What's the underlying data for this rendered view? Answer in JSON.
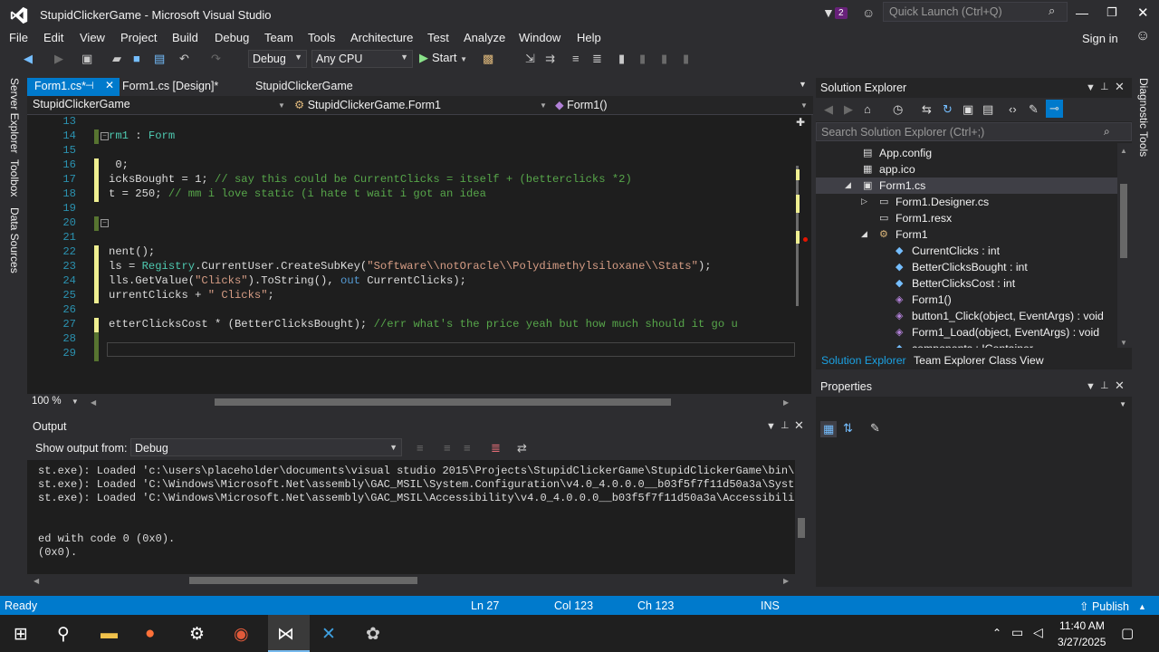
{
  "title_bar": {
    "title": "StupidClickerGame - Microsoft Visual Studio",
    "notification_count": "2",
    "quick_launch_placeholder": "Quick Launch (Ctrl+Q)"
  },
  "menu": {
    "items": [
      "File",
      "Edit",
      "View",
      "Project",
      "Build",
      "Debug",
      "Team",
      "Tools",
      "Architecture",
      "Test",
      "Analyze",
      "Window",
      "Help"
    ],
    "sign_in": "Sign in"
  },
  "toolbar": {
    "configuration": "Debug",
    "platform": "Any CPU",
    "start_label": "Start"
  },
  "left_sidebar": {
    "tabs": [
      "Server Explorer",
      "Toolbox",
      "Data Sources"
    ]
  },
  "editor": {
    "tabs": [
      "Form1.cs*",
      "Form1.cs [Design]*",
      "StupidClickerGame"
    ],
    "nav": {
      "project": "StupidClickerGame",
      "class": "StupidClickerGame.Form1",
      "member": "Form1()"
    },
    "lines": [
      {
        "num": "13",
        "text": ""
      },
      {
        "num": "14",
        "text": "rm1 : Form"
      },
      {
        "num": "15",
        "text": ""
      },
      {
        "num": "16",
        "text": " 0;"
      },
      {
        "num": "17",
        "text": "icksBought = 1; // say this could be CurrentClicks = itself + (betterclicks *2)"
      },
      {
        "num": "18",
        "text": "t = 250; // mm i love static (i hate t wait i got an idea"
      },
      {
        "num": "19",
        "text": ""
      },
      {
        "num": "20",
        "text": ""
      },
      {
        "num": "21",
        "text": ""
      },
      {
        "num": "22",
        "text": "nent();"
      },
      {
        "num": "23",
        "text": "ls = Registry.CurrentUser.CreateSubKey(\"Software\\\\notOracle\\\\Polydimethylsiloxane\\\\Stats\");"
      },
      {
        "num": "24",
        "text": "lls.GetValue(\"Clicks\").ToString(), out CurrentClicks);"
      },
      {
        "num": "25",
        "text": "urrentClicks + \" Clicks\";"
      },
      {
        "num": "26",
        "text": ""
      },
      {
        "num": "27",
        "text": "etterClicksCost * (BetterClicksBought); //err what's the price yeah but how much should it go u"
      },
      {
        "num": "28",
        "text": ""
      },
      {
        "num": "29",
        "text": ""
      }
    ],
    "zoom": "100 %"
  },
  "output": {
    "title": "Output",
    "show_from_label": "Show output from:",
    "source": "Debug",
    "lines": [
      "st.exe): Loaded 'c:\\users\\placeholder\\documents\\visual studio 2015\\Projects\\StupidClickerGame\\StupidClickerGame\\bin\\Debu",
      "st.exe): Loaded 'C:\\Windows\\Microsoft.Net\\assembly\\GAC_MSIL\\System.Configuration\\v4.0_4.0.0.0__b03f5f7f11d50a3a\\System.C",
      "st.exe): Loaded 'C:\\Windows\\Microsoft.Net\\assembly\\GAC_MSIL\\Accessibility\\v4.0_4.0.0.0__b03f5f7f11d50a3a\\Accessibility.d",
      "",
      "",
      "ed with code 0 (0x0).",
      "(0x0)."
    ]
  },
  "solution_explorer": {
    "title": "Solution Explorer",
    "search_placeholder": "Search Solution Explorer (Ctrl+;)",
    "tree": [
      {
        "label": "App.config",
        "icon": "config-file-icon"
      },
      {
        "label": "app.ico",
        "icon": "icon-file-icon"
      },
      {
        "label": "Form1.cs",
        "icon": "form-icon"
      },
      {
        "label": "Form1.Designer.cs",
        "icon": "cs-file-icon"
      },
      {
        "label": "Form1.resx",
        "icon": "resx-file-icon"
      },
      {
        "label": "Form1",
        "icon": "class-icon"
      },
      {
        "label": "CurrentClicks : int",
        "icon": "field-icon"
      },
      {
        "label": "BetterClicksBought : int",
        "icon": "field-icon"
      },
      {
        "label": "BetterClicksCost : int",
        "icon": "field-icon"
      },
      {
        "label": "Form1()",
        "icon": "method-icon"
      },
      {
        "label": "button1_Click(object, EventArgs) : void",
        "icon": "method-icon"
      },
      {
        "label": "Form1_Load(object, EventArgs) : void",
        "icon": "method-icon"
      },
      {
        "label": "components : IContainer",
        "icon": "field-icon"
      }
    ],
    "bottom_tabs": [
      "Solution Explorer",
      "Team Explorer",
      "Class View"
    ]
  },
  "properties": {
    "title": "Properties"
  },
  "right_sidebar": {
    "tab": "Diagnostic Tools"
  },
  "status_bar": {
    "state": "Ready",
    "line": "Ln 27",
    "col": "Col 123",
    "ch": "Ch 123",
    "mode": "INS",
    "publish": "Publish"
  },
  "taskbar": {
    "time": "11:40 AM",
    "date": "3/27/2025"
  },
  "colors": {
    "accent": "#007acc",
    "background": "#2d2d30",
    "editor": "#1e1e1e"
  }
}
